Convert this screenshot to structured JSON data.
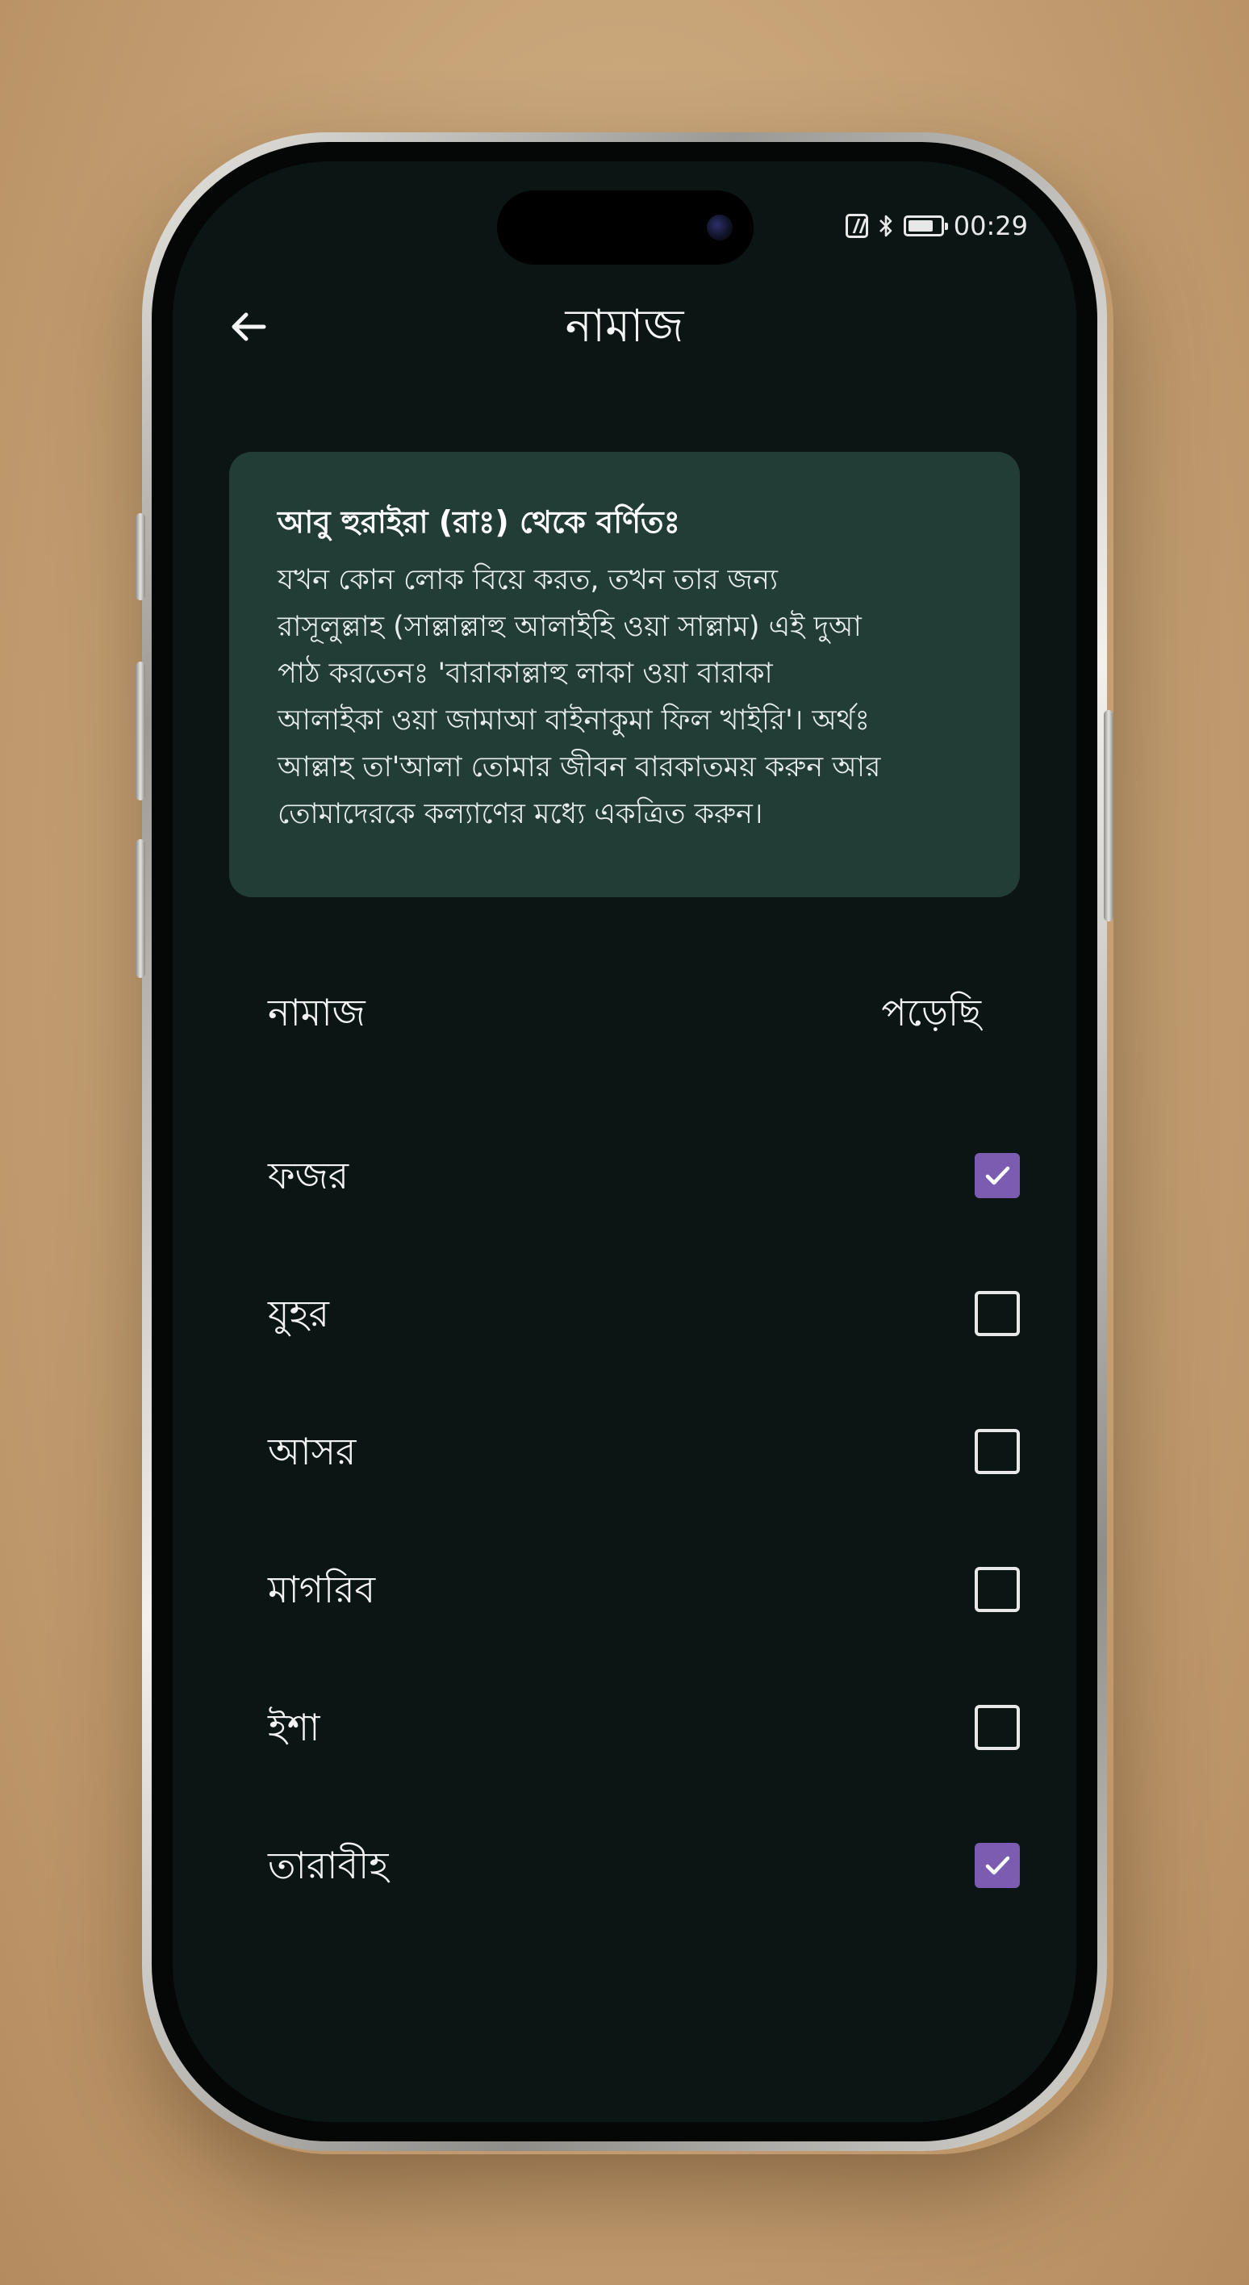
{
  "status_bar": {
    "time": "00:29",
    "icons": [
      "nfc-icon",
      "bluetooth-icon",
      "battery-icon"
    ],
    "battery_level": 0.8
  },
  "header": {
    "back_icon": "arrow-left-icon",
    "title": "নামাজ"
  },
  "hadith": {
    "title": "আবু হুরাইরা (রাঃ) থেকে বর্ণিতঃ",
    "lines": [
      "যখন কোন লোক বিয়ে করত, তখন তার জন্য",
      "রাসূলুল্লাহ (সাল্লাল্লাহু আলাইহি ওয়া সাল্লাম) এই দুআ",
      "পাঠ করতেনঃ 'বারাকাল্লাহু লাকা ওয়া বারাকা",
      "আলাইকা ওয়া জামাআ বাইনাকুমা ফিল খাইরি'। অর্থঃ",
      "আল্লাহ তা'আলা তোমার জীবন বারকাতময় করুন আর",
      "তোমাদেরকে কল্যাণের মধ্যে একত্রিত করুন।"
    ]
  },
  "table": {
    "col_name": "নামাজ",
    "col_done": "পড়েছি"
  },
  "prayers": [
    {
      "name": "ফজর",
      "checked": true
    },
    {
      "name": "যুহর",
      "checked": false
    },
    {
      "name": "আসর",
      "checked": false
    },
    {
      "name": "মাগরিব",
      "checked": false
    },
    {
      "name": "ইশা",
      "checked": false
    },
    {
      "name": "তারাবীহ",
      "checked": true
    }
  ],
  "colors": {
    "screen_bg": "#0b1614",
    "card_bg": "#223c36",
    "checkbox_checked": "#7b5cb0",
    "text": "#f2f2f2"
  }
}
